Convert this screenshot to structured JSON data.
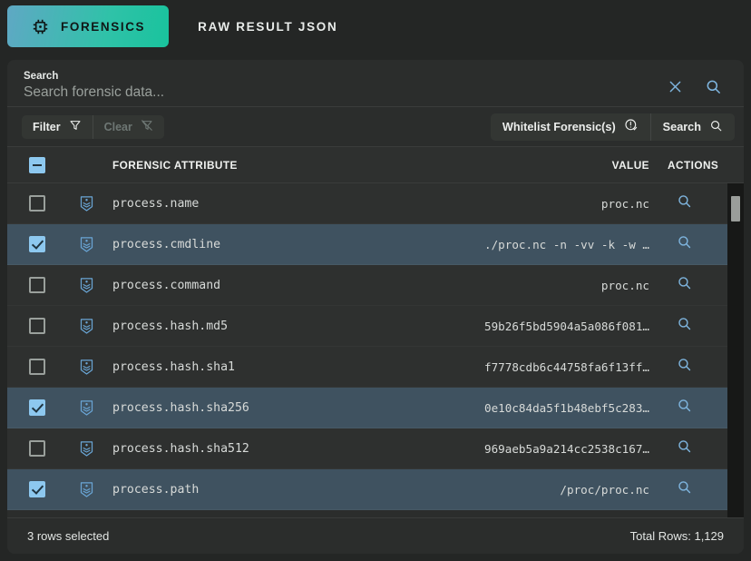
{
  "tabs": [
    {
      "label": "FORENSICS",
      "icon": "chip-icon",
      "active": true
    },
    {
      "label": "RAW RESULT JSON",
      "icon": "",
      "active": false
    }
  ],
  "search": {
    "label": "Search",
    "placeholder": "Search forensic data...",
    "value": "",
    "clear_icon": "close-icon",
    "submit_icon": "search-icon"
  },
  "filter_bar": {
    "filter_label": "Filter",
    "filter_icon": "filter-icon",
    "clear_label": "Clear",
    "clear_icon": "filter-off-icon",
    "whitelist_label": "Whitelist Forensic(s)",
    "whitelist_icon": "alert-check-icon",
    "search_label": "Search",
    "search_icon": "search-icon"
  },
  "table": {
    "columns": {
      "attribute": "FORENSIC ATTRIBUTE",
      "value": "VALUE",
      "actions": "ACTIONS"
    },
    "header_checkbox_state": "indeterminate",
    "row_icon": "shield-badge-icon",
    "row_action_icon": "search-icon",
    "rows": [
      {
        "selected": false,
        "attribute": "process.name",
        "value": "proc.nc"
      },
      {
        "selected": true,
        "attribute": "process.cmdline",
        "value": "./proc.nc -n -vv -k -w …"
      },
      {
        "selected": false,
        "attribute": "process.command",
        "value": "proc.nc"
      },
      {
        "selected": false,
        "attribute": "process.hash.md5",
        "value": "59b26f5bd5904a5a086f081…"
      },
      {
        "selected": false,
        "attribute": "process.hash.sha1",
        "value": "f7778cdb6c44758fa6f13ff…"
      },
      {
        "selected": true,
        "attribute": "process.hash.sha256",
        "value": "0e10c84da5f1b48ebf5c283…"
      },
      {
        "selected": false,
        "attribute": "process.hash.sha512",
        "value": "969aeb5a9a214cc2538c167…"
      },
      {
        "selected": true,
        "attribute": "process.path",
        "value": "/proc/proc.nc"
      }
    ]
  },
  "footer": {
    "selection_text": "3 rows selected",
    "total_rows_text": "Total Rows: 1,129"
  },
  "colors": {
    "accent_teal": "#19c39d",
    "accent_blue": "#7fb6e0",
    "checkbox_blue": "#8dc8ef",
    "row_selected": "#3f5260",
    "page_bg": "#242625",
    "card_bg": "#2b2d2c"
  }
}
